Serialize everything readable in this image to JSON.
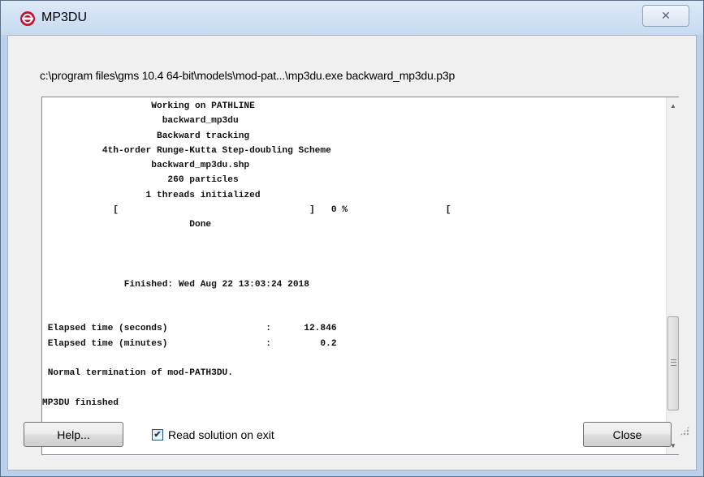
{
  "window": {
    "title": "MP3DU",
    "close_glyph": "✕"
  },
  "command_line": "c:\\program files\\gms 10.4 64-bit\\models\\mod-pat...\\mp3du.exe backward_mp3du.p3p",
  "output_lines": [
    "                    Working on PATHLINE",
    "                      backward_mp3du",
    "                     Backward tracking",
    "           4th-order Runge-Kutta Step-doubling Scheme",
    "                    backward_mp3du.shp",
    "                       260 particles",
    "                   1 threads initialized",
    "             [                                   ]   0 %                  [",
    "                           Done",
    "",
    "",
    "",
    "               Finished: Wed Aug 22 13:03:24 2018",
    "",
    "",
    " Elapsed time (seconds)                  :      12.846",
    " Elapsed time (minutes)                  :         0.2",
    "",
    " Normal termination of mod-PATH3DU.",
    "",
    "MP3DU finished"
  ],
  "buttons": {
    "help_label": "Help...",
    "close_label": "Close"
  },
  "checkbox": {
    "label": "Read solution on exit",
    "checked": true,
    "check_glyph": "✔"
  },
  "icons": {
    "app_icon": "app-logo-icon",
    "scroll_up": "scroll-up-arrow-icon",
    "scroll_down": "scroll-down-arrow-icon",
    "accent_color": "#c8102e"
  }
}
